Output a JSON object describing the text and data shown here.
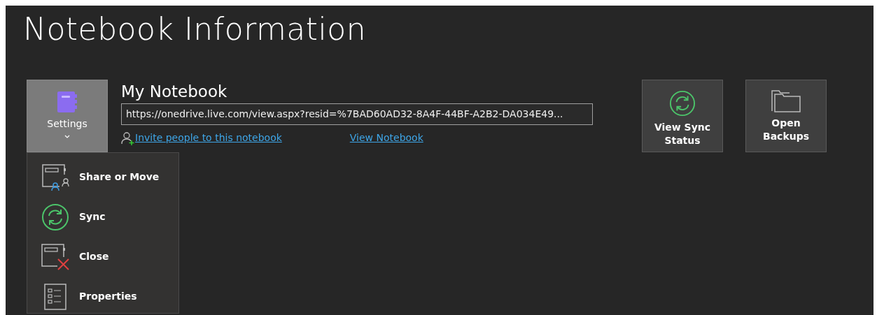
{
  "title": "Notebook Information",
  "settings_button": {
    "label": "Settings",
    "expanded": true
  },
  "notebook": {
    "name": "My Notebook",
    "url": "https://onedrive.live.com/view.aspx?resid=%7BAD60AD32-8A4F-44BF-A2B2-DA034E49...",
    "invite_link": "Invite people to this notebook",
    "view_link": "View Notebook"
  },
  "actions": [
    {
      "kind": "sync",
      "label": "View Sync Status"
    },
    {
      "kind": "backups",
      "label": "Open Backups"
    }
  ],
  "menu": [
    {
      "kind": "share",
      "label": "Share or Move"
    },
    {
      "kind": "sync",
      "label": "Sync"
    },
    {
      "kind": "close",
      "label": "Close"
    },
    {
      "kind": "properties",
      "label": "Properties"
    }
  ]
}
